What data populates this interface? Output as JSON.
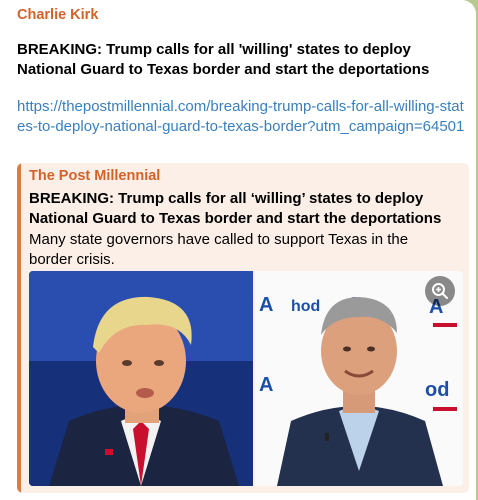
{
  "message": {
    "sender": "Charlie Kirk",
    "headline": "BREAKING: Trump calls for all 'willing' states to deploy National Guard to Texas border and start the deportations",
    "link_text": "https://thepostmillennial.com/breaking-trump-calls-for-all-willing-states-to-deploy-national-guard-to-texas-border?utm_campaign=64501"
  },
  "preview": {
    "site_name": "The Post Millennial",
    "title": "BREAKING: Trump calls for all ‘willing’ states to deploy National Guard to Texas border and start the deportations",
    "description": "Many state governors have called to support Texas in the border crisis."
  },
  "icons": {
    "zoom": "zoom-in-icon"
  },
  "colors": {
    "accent": "#d1632a",
    "link": "#3a7fbd",
    "preview_bg": "#fcefe7",
    "chat_bg": "#b7c98f"
  }
}
